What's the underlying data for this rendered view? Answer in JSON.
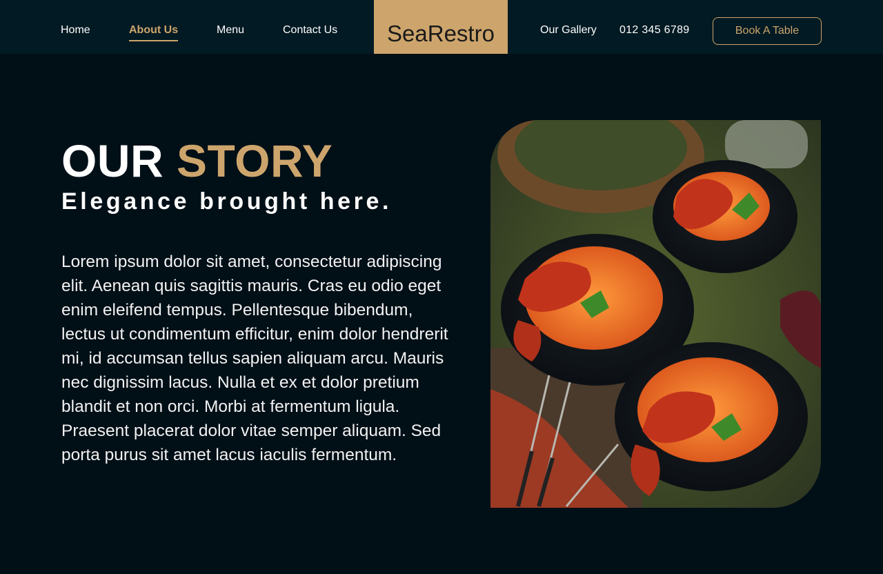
{
  "nav": {
    "left_items": [
      {
        "label": "Home",
        "active": false
      },
      {
        "label": "About Us",
        "active": true
      },
      {
        "label": "Menu",
        "active": false
      },
      {
        "label": "Contact Us",
        "active": false
      }
    ],
    "logo": "SeaRestro",
    "gallery_label": "Our Gallery",
    "phone": "012 345 6789",
    "book_label": "Book A Table"
  },
  "story": {
    "title_white": "OUR",
    "title_gold": "STORY",
    "subtitle": "Elegance brought here.",
    "body": "Lorem ipsum dolor sit amet, consectetur adipiscing elit. Aenean quis sagittis mauris. Cras eu odio eget enim eleifend tempus. Pellentesque bibendum, lectus ut condimentum efficitur, enim dolor hendrerit mi, id accumsan tellus sapien aliquam arcu. Mauris nec dignissim lacus. Nulla et ex et dolor pretium blandit et non orci. Morbi at fermentum ligula. Praesent placerat dolor vitae semper aliquam. Sed porta purus sit amet lacus iaculis fermentum."
  },
  "colors": {
    "background": "#010f17",
    "nav_background": "#021a23",
    "accent_gold": "#cda56c"
  }
}
